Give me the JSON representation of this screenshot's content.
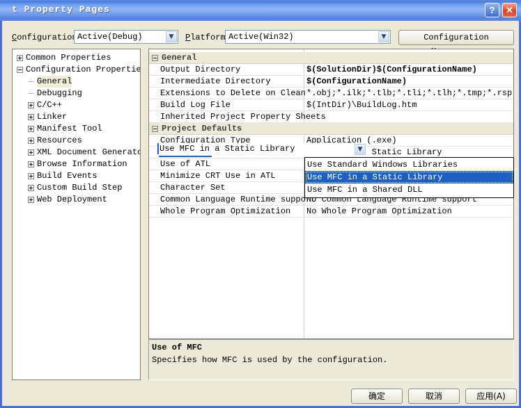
{
  "window": {
    "title": "t Property Pages",
    "help_button": "?",
    "close_button": "✕"
  },
  "toolbar": {
    "configuration_label": "Configuration:",
    "configuration_value": "Active(Debug)",
    "platform_label": "Platform:",
    "platform_value": "Active(Win32)",
    "config_manager_button": "Configuration Manager...",
    "dropdown_arrow": "▼"
  },
  "tree": {
    "items": [
      {
        "label": "Common Properties",
        "indent": 0,
        "toggle": "plus",
        "selected": false
      },
      {
        "label": "Configuration Properties",
        "indent": 0,
        "toggle": "minus",
        "selected": false
      },
      {
        "label": "General",
        "indent": 1,
        "toggle": "none",
        "selected": true
      },
      {
        "label": "Debugging",
        "indent": 1,
        "toggle": "none",
        "selected": false
      },
      {
        "label": "C/C++",
        "indent": 1,
        "toggle": "plus",
        "selected": false
      },
      {
        "label": "Linker",
        "indent": 1,
        "toggle": "plus",
        "selected": false
      },
      {
        "label": "Manifest Tool",
        "indent": 1,
        "toggle": "plus",
        "selected": false
      },
      {
        "label": "Resources",
        "indent": 1,
        "toggle": "plus",
        "selected": false
      },
      {
        "label": "XML Document Generator",
        "indent": 1,
        "toggle": "plus",
        "selected": false
      },
      {
        "label": "Browse Information",
        "indent": 1,
        "toggle": "plus",
        "selected": false
      },
      {
        "label": "Build Events",
        "indent": 1,
        "toggle": "plus",
        "selected": false
      },
      {
        "label": "Custom Build Step",
        "indent": 1,
        "toggle": "plus",
        "selected": false
      },
      {
        "label": "Web Deployment",
        "indent": 1,
        "toggle": "plus",
        "selected": false
      }
    ]
  },
  "grid": {
    "categories": [
      {
        "name": "General",
        "rows": [
          {
            "name": "Output Directory",
            "value": "$(SolutionDir)$(ConfigurationName)",
            "bold": true
          },
          {
            "name": "Intermediate Directory",
            "value": "$(ConfigurationName)",
            "bold": true
          },
          {
            "name": "Extensions to Delete on Clean",
            "value": "*.obj;*.ilk;*.tlb;*.tli;*.tlh;*.tmp;*.rsp;*.pgc;*",
            "bold": false
          },
          {
            "name": "Build Log File",
            "value": "$(IntDir)\\BuildLog.htm",
            "bold": false
          },
          {
            "name": "Inherited Project Property Sheets",
            "value": "",
            "bold": false
          }
        ]
      },
      {
        "name": "Project Defaults",
        "rows": [
          {
            "name": "Configuration Type",
            "value": "Application (.exe)",
            "bold": false
          },
          {
            "name": "Use of MFC",
            "value": "Use MFC in a Static Library",
            "bold": false,
            "selected": true
          },
          {
            "name": "Use of ATL",
            "value": "",
            "bold": false
          },
          {
            "name": "Minimize CRT Use in ATL",
            "value": "",
            "bold": false
          },
          {
            "name": "Character Set",
            "value": "",
            "bold": false
          },
          {
            "name": "Common Language Runtime support",
            "value": "No Common Language Runtime support",
            "bold": false
          },
          {
            "name": "Whole Program Optimization",
            "value": "No Whole Program Optimization",
            "bold": false
          }
        ]
      }
    ],
    "editor": {
      "value": "Use MFC in a Static Library",
      "arrow": "▼"
    },
    "dropdown": {
      "options": [
        {
          "label": "Use Standard Windows Libraries",
          "highlighted": false
        },
        {
          "label": "Use MFC in a Static Library",
          "highlighted": true
        },
        {
          "label": "Use MFC in a Shared DLL",
          "highlighted": false
        }
      ]
    }
  },
  "description": {
    "title": "Use of MFC",
    "body": "Specifies how MFC is used by the configuration."
  },
  "footer": {
    "ok_button": "确定",
    "cancel_button": "取消",
    "apply_button": "应用(A)"
  },
  "colors": {
    "accent": "#1d5fc4",
    "titlebar": "#4a7ddb",
    "face": "#ece9d8"
  }
}
